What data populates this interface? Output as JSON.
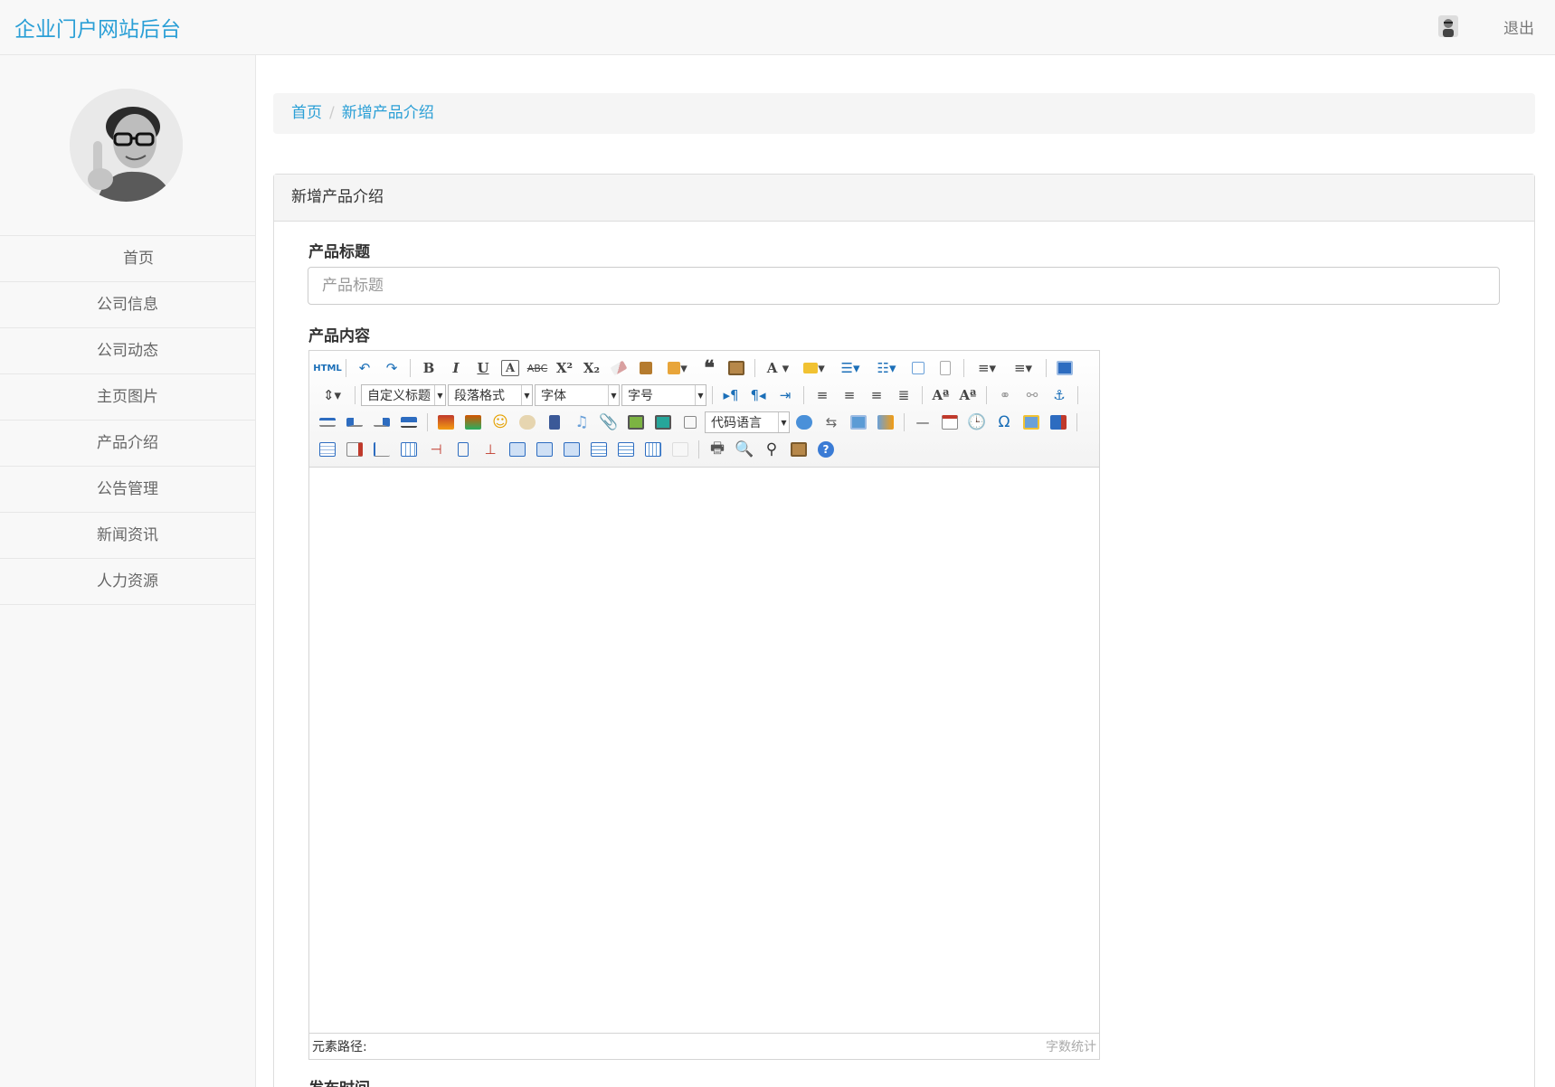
{
  "navbar": {
    "brand": "企业门户网站后台",
    "logout": "退出"
  },
  "sidebar": {
    "items": [
      {
        "label": "首页"
      },
      {
        "label": "公司信息"
      },
      {
        "label": "公司动态"
      },
      {
        "label": "主页图片"
      },
      {
        "label": "产品介绍"
      },
      {
        "label": "公告管理"
      },
      {
        "label": "新闻资讯"
      },
      {
        "label": "人力资源"
      }
    ]
  },
  "breadcrumb": {
    "home": "首页",
    "current": "新增产品介绍",
    "separator": "/"
  },
  "panel": {
    "heading": "新增产品介绍"
  },
  "form": {
    "title_label": "产品标题",
    "title_placeholder": "产品标题",
    "content_label": "产品内容",
    "date_label": "发布时间"
  },
  "editor": {
    "html_button": "HTML",
    "custom_title": "自定义标题",
    "paragraph": "段落格式",
    "font_family": "字体",
    "font_size": "字号",
    "code_language": "代码语言",
    "element_path": "元素路径:",
    "word_count": "字数统计"
  },
  "colors": {
    "accent": "#2a9fd6",
    "sidebar_bg": "#f8f8f8",
    "border": "#e7e7e7"
  }
}
